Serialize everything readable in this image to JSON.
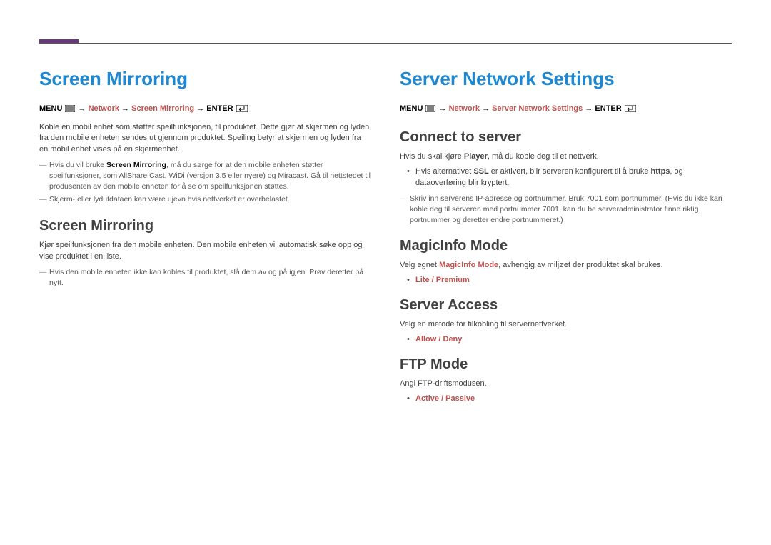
{
  "left": {
    "title": "Screen Mirroring",
    "path": {
      "menu": "MENU",
      "seg1": "Network",
      "seg2": "Screen Mirroring",
      "enter": "ENTER"
    },
    "intro": "Koble en mobil enhet som støtter speilfunksjonen, til produktet. Dette gjør at skjermen og lyden fra den mobile enheten sendes ut gjennom produktet. Speiling betyr at skjermen og lyden fra en mobil enhet vises på en skjermenhet.",
    "note1_pre": "Hvis du vil bruke ",
    "note1_bold": "Screen Mirroring",
    "note1_post": ", må du sørge for at den mobile enheten støtter speilfunksjoner, som AllShare Cast, WiDi (versjon 3.5 eller nyere) og Miracast. Gå til nettstedet til produsenten av den mobile enheten for å se om speilfunksjonen støttes.",
    "note2": "Skjerm- eller lydutdataen kan være ujevn hvis nettverket er overbelastet.",
    "sub_title": "Screen Mirroring",
    "sub_body": "Kjør speilfunksjonen fra den mobile enheten. Den mobile enheten vil automatisk søke opp og vise produktet i en liste.",
    "sub_note": "Hvis den mobile enheten ikke kan kobles til produktet, slå dem av og på igjen. Prøv deretter på nytt."
  },
  "right": {
    "title": "Server Network Settings",
    "path": {
      "menu": "MENU",
      "seg1": "Network",
      "seg2": "Server Network Settings",
      "enter": "ENTER"
    },
    "connect": {
      "heading": "Connect to server",
      "body_pre": "Hvis du skal kjøre ",
      "body_bold": "Player",
      "body_post": ", må du koble deg til et nettverk.",
      "bullet_pre": "Hvis alternativet ",
      "bullet_bold1": "SSL",
      "bullet_mid": " er aktivert, blir serveren konfigurert til å bruke ",
      "bullet_bold2": "https",
      "bullet_post": ", og dataoverføring blir kryptert.",
      "note": "Skriv inn serverens IP-adresse og portnummer. Bruk 7001 som portnummer. (Hvis du ikke kan koble deg til serveren med portnummer 7001, kan du be serveradministrator finne riktig portnummer og deretter endre portnummeret.)"
    },
    "magicinfo": {
      "heading": "MagicInfo Mode",
      "body_pre": "Velg egnet ",
      "body_bold": "MagicInfo Mode",
      "body_post": ", avhengig av miljøet der produktet skal brukes.",
      "option": "Lite / Premium"
    },
    "server_access": {
      "heading": "Server Access",
      "body": "Velg en metode for tilkobling til servernettverket.",
      "option": "Allow / Deny"
    },
    "ftp": {
      "heading": "FTP Mode",
      "body": "Angi FTP-driftsmodusen.",
      "option": "Active / Passive"
    }
  }
}
